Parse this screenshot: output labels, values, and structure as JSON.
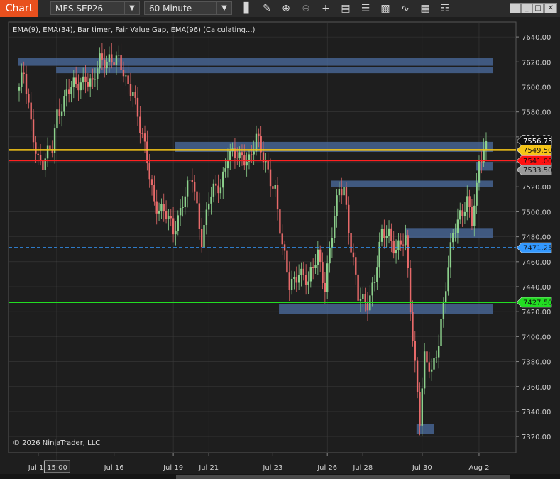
{
  "toolbar": {
    "chart_tab": "Chart",
    "instrument": "MES SEP26",
    "interval": "60 Minute",
    "tools": [
      "bar-style-icon",
      "pencil-icon",
      "zoom-in-icon",
      "zoom-out-icon",
      "crosshair-icon",
      "data-box-icon",
      "properties-icon",
      "strategies-icon",
      "indicators-icon",
      "templates-icon",
      "drawing-objects-icon"
    ]
  },
  "chart_data": {
    "type": "candlestick",
    "indicator_label": "EMA(9), EMA(34), Bar timer, Fair Value Gap, EMA(96) (Calculating...)",
    "copyright": "© 2026 NinjaTrader, LLC",
    "ylim": [
      7307,
      7652
    ],
    "y_ticks": [
      7320,
      7340,
      7360,
      7380,
      7400,
      7420,
      7440,
      7460,
      7480,
      7500,
      7520,
      7540,
      7560,
      7580,
      7600,
      7620,
      7640
    ],
    "y_tick_labels": [
      "7320.00",
      "7340.00",
      "7360.00",
      "7380.00",
      "7400.00",
      "7420.00",
      "7440.00",
      "7460.00",
      "7480.00",
      "7500.00",
      "7520.00",
      "7540.00",
      "7560.00",
      "7580.00",
      "7600.00",
      "7620.00",
      "7640.00"
    ],
    "x_labels": [
      {
        "label": "Jul 14",
        "bar": 8
      },
      {
        "label": "15:00",
        "bar": 16
      },
      {
        "label": "Jul 16",
        "bar": 40
      },
      {
        "label": "Jul 19",
        "bar": 65
      },
      {
        "label": "Jul 21",
        "bar": 80
      },
      {
        "label": "Jul 23",
        "bar": 107
      },
      {
        "label": "Jul 26",
        "bar": 130
      },
      {
        "label": "Jul 28",
        "bar": 145
      },
      {
        "label": "Jul 30",
        "bar": 170
      },
      {
        "label": "Aug 2",
        "bar": 194
      }
    ],
    "bar_count": 198,
    "crosshair_bar": 16,
    "keypoints": [
      [
        0,
        7600
      ],
      [
        2,
        7608
      ],
      [
        5,
        7570
      ],
      [
        8,
        7545
      ],
      [
        10,
        7538
      ],
      [
        14,
        7550
      ],
      [
        16,
        7580
      ],
      [
        20,
        7595
      ],
      [
        24,
        7600
      ],
      [
        28,
        7610
      ],
      [
        31,
        7600
      ],
      [
        34,
        7620
      ],
      [
        38,
        7625
      ],
      [
        42,
        7618
      ],
      [
        45,
        7605
      ],
      [
        48,
        7600
      ],
      [
        51,
        7565
      ],
      [
        54,
        7540
      ],
      [
        57,
        7510
      ],
      [
        62,
        7495
      ],
      [
        65,
        7485
      ],
      [
        69,
        7510
      ],
      [
        73,
        7525
      ],
      [
        77,
        7480
      ],
      [
        80,
        7510
      ],
      [
        85,
        7520
      ],
      [
        88,
        7550
      ],
      [
        93,
        7540
      ],
      [
        97,
        7545
      ],
      [
        100,
        7560
      ],
      [
        103,
        7540
      ],
      [
        108,
        7520
      ],
      [
        111,
        7470
      ],
      [
        114,
        7440
      ],
      [
        118,
        7455
      ],
      [
        122,
        7440
      ],
      [
        126,
        7470
      ],
      [
        129,
        7440
      ],
      [
        132,
        7480
      ],
      [
        135,
        7520
      ],
      [
        137,
        7522
      ],
      [
        140,
        7470
      ],
      [
        143,
        7430
      ],
      [
        147,
        7430
      ],
      [
        150,
        7445
      ],
      [
        153,
        7480
      ],
      [
        156,
        7485
      ],
      [
        159,
        7470
      ],
      [
        163,
        7475
      ],
      [
        165,
        7425
      ],
      [
        167,
        7380
      ],
      [
        169,
        7335
      ],
      [
        171,
        7380
      ],
      [
        174,
        7370
      ],
      [
        177,
        7400
      ],
      [
        180,
        7440
      ],
      [
        183,
        7480
      ],
      [
        186,
        7500
      ],
      [
        189,
        7510
      ],
      [
        191,
        7490
      ],
      [
        193,
        7515
      ],
      [
        194,
        7540
      ],
      [
        196,
        7552
      ],
      [
        197,
        7556
      ]
    ],
    "fair_value_gaps": [
      {
        "from_bar": 0,
        "to_bar": 200,
        "low": 7617,
        "high": 7623
      },
      {
        "from_bar": 16,
        "to_bar": 200,
        "low": 7611,
        "high": 7616
      },
      {
        "from_bar": 66,
        "to_bar": 200,
        "low": 7548,
        "high": 7556
      },
      {
        "from_bar": 132,
        "to_bar": 200,
        "low": 7520,
        "high": 7525
      },
      {
        "from_bar": 163,
        "to_bar": 200,
        "low": 7479,
        "high": 7487
      },
      {
        "from_bar": 193,
        "to_bar": 200,
        "low": 7533,
        "high": 7540
      },
      {
        "from_bar": 110,
        "to_bar": 200,
        "low": 7418,
        "high": 7426
      },
      {
        "from_bar": 168,
        "to_bar": 175,
        "low": 7322,
        "high": 7330
      }
    ],
    "price_lines": [
      {
        "name": "yellow-level",
        "price": 7549.5,
        "color": "#f5c518",
        "style": "solid",
        "width": 2.5
      },
      {
        "name": "red-level",
        "price": 7541,
        "color": "#ff2020",
        "style": "solid",
        "width": 1.6
      },
      {
        "name": "white-level",
        "price": 7533.5,
        "color": "#c8c8c8",
        "style": "solid",
        "width": 1
      },
      {
        "name": "blue-level",
        "price": 7471.25,
        "color": "#3399ff",
        "style": "dashed",
        "width": 1.5
      },
      {
        "name": "green-level",
        "price": 7427.5,
        "color": "#22dd22",
        "style": "solid",
        "width": 2
      }
    ],
    "price_tags": [
      {
        "label": "7556.75",
        "price": 7556.75,
        "bg": "#111111",
        "fg": "#ffffff"
      },
      {
        "label": "7549.50",
        "price": 7549.5,
        "bg": "#f5c518",
        "fg": "#111111"
      },
      {
        "label": "7541.00",
        "price": 7541,
        "bg": "#ff1010",
        "fg": "#111111"
      },
      {
        "label": "7533.50",
        "price": 7533.5,
        "bg": "#9a9a9a",
        "fg": "#111111"
      },
      {
        "label": "7471.25",
        "price": 7471.25,
        "bg": "#3399ff",
        "fg": "#111111"
      },
      {
        "label": "7427.50",
        "price": 7427.5,
        "bg": "#22dd22",
        "fg": "#111111"
      }
    ],
    "colors": {
      "background": "#1e1e1e",
      "grid": "#3a3a3a",
      "up": "#8cd08c",
      "down": "#e86a6a",
      "fvg": "#4a6a9c",
      "axis_text": "#d0d0d0"
    }
  }
}
